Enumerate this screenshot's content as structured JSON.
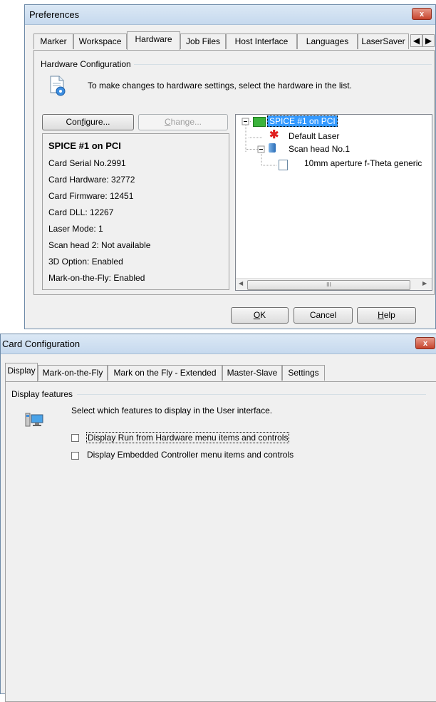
{
  "preferences": {
    "title": "Preferences",
    "close_label": "x",
    "tabs": [
      "Marker",
      "Workspace",
      "Hardware",
      "Job Files",
      "Host Interface",
      "Languages",
      "LaserSaver"
    ],
    "active_tab": "Hardware",
    "group_title": "Hardware Configuration",
    "instruction": "To make changes to hardware settings, select the hardware in the list.",
    "configure_pre": "Con",
    "configure_u": "f",
    "configure_post": "igure...",
    "change_u": "C",
    "change_post": "hange...",
    "card_info": {
      "title": "SPICE #1 on PCI",
      "lines": [
        "Card Serial No.2991",
        "Card Hardware: 32772",
        "Card Firmware: 12451",
        "Card DLL: 12267",
        "Laser Mode: 1",
        "Scan head 2: Not available",
        "3D Option: Enabled",
        "Mark-on-the-Fly: Enabled"
      ]
    },
    "tree": {
      "root": "SPICE #1 on PCI",
      "laser": "Default Laser",
      "scan_head": "Scan head No.1",
      "lens": "10mm aperture f-Theta generic"
    },
    "scroll_thumb": "III",
    "ok_u": "O",
    "ok_post": "K",
    "cancel_label": "Cancel",
    "help_u": "H",
    "help_post": "elp"
  },
  "card_config": {
    "title": "Card Configuration",
    "close_label": "x",
    "tabs": [
      "Display",
      "Mark-on-the-Fly",
      "Mark on the Fly - Extended",
      "Master-Slave",
      "Settings"
    ],
    "active_tab": "Display",
    "group_title": "Display features",
    "instruction": "Select which features to display in the User interface.",
    "options": [
      {
        "label": "Display Run from Hardware menu items and controls",
        "checked": false
      },
      {
        "label": "Display Embedded Controller menu items and controls",
        "checked": false
      }
    ]
  },
  "colors": {
    "tree_selection": "#3399ff",
    "close_button": "#c7442d"
  }
}
